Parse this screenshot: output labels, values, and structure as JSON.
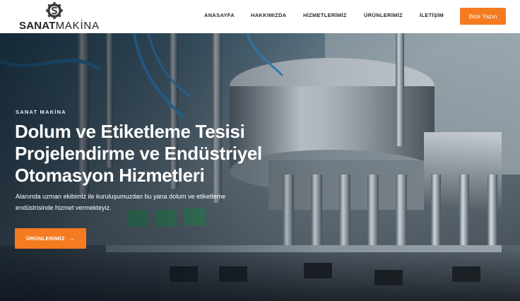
{
  "brand": {
    "name_bold": "SANAT",
    "name_light": "MAKİNA",
    "accent_color": "#f47b20"
  },
  "nav": {
    "items": [
      {
        "label": "ANASAYFA"
      },
      {
        "label": "HAKKIMIZDA"
      },
      {
        "label": "HİZMETLERİMİZ"
      },
      {
        "label": "ÜRÜNLERİMİZ"
      },
      {
        "label": "İLETİŞİM"
      }
    ],
    "cta_label": "Bize Yazın"
  },
  "hero": {
    "eyebrow": "SANAT MAKİNA",
    "headline": "Dolum ve Etiketleme Tesisi Projelendirme ve Endüstriyel Otomasyon Hizmetleri",
    "subtext": "Alanında uzman ekibimiz ile kuruluşumuzdan bu yana dolum ve etiketleme endüstrisinde hizmet vermekteyiz.",
    "button_label": "ÜRÜNLERİMİZ",
    "button_icon": "arrow-right-icon",
    "background": "industrial filling machine photo"
  }
}
